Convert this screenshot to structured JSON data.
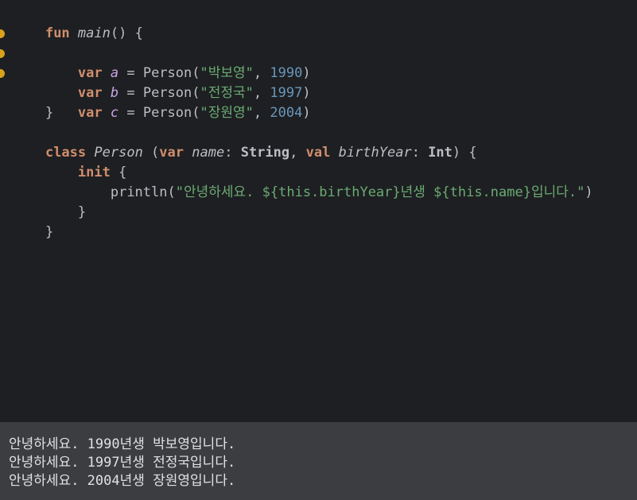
{
  "editor": {
    "line1": {
      "kw": "fun",
      "name": "main",
      "rest": "() {"
    },
    "line2": {
      "kw": "var",
      "name": "a",
      "pre": " = Person(",
      "str": "\"박보영\"",
      "sep": ", ",
      "num": "1990",
      "end": ")"
    },
    "line3": {
      "kw": "var",
      "name": "b",
      "pre": " = Person(",
      "str": "\"전정국\"",
      "sep": ", ",
      "num": "1997",
      "end": ")"
    },
    "line4": {
      "kw": "var",
      "name": "c",
      "pre": " = Person(",
      "str": "\"장원영\"",
      "sep": ", ",
      "num": "2004",
      "end": ")"
    },
    "line5": "}",
    "line7": {
      "kw": "class",
      "name": "Person",
      "p1": " (",
      "kw2": "var",
      "param1": "name",
      "colon1": ": ",
      "type1": "String",
      "comma": ", ",
      "kw3": "val",
      "param2": "birthYear",
      "colon2": ": ",
      "type2": "Int",
      "end": ") {"
    },
    "line8": {
      "kw": "init",
      "rest": " {"
    },
    "line9": {
      "call": "println(",
      "str": "\"안녕하세요. ${this.birthYear}년생 ${this.name}입니다.\"",
      "end": ")"
    },
    "line10": "}",
    "line11": "}"
  },
  "console": {
    "lines": [
      "안녕하세요. 1990년생 박보영입니다.",
      "안녕하세요. 1997년생 전정국입니다.",
      "안녕하세요. 2004년생 장원영입니다."
    ]
  },
  "colors": {
    "editor_bg": "#1e1f22",
    "console_bg": "#3b3d40",
    "keyword": "#cf8e6d",
    "string": "#6aab73",
    "number": "#6897bb",
    "gutter_marker": "#d9a21b"
  }
}
